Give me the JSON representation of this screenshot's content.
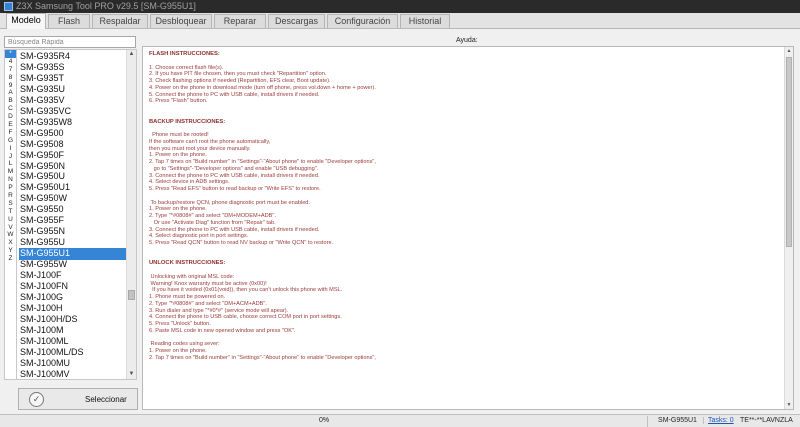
{
  "window": {
    "title": "Z3X Samsung Tool PRO v29.5 [SM-G955U1]"
  },
  "tabs": [
    "Modelo",
    "Flash",
    "Respaldar",
    "Desbloquear",
    "Reparar",
    "Descargas",
    "Configuración",
    "Historial"
  ],
  "active_tab": "Modelo",
  "search": {
    "placeholder": "Búsqueda Rápida",
    "value": ""
  },
  "alphabet": [
    "*",
    "4",
    "7",
    "8",
    "9",
    "A",
    "B",
    "C",
    "D",
    "E",
    "F",
    "G",
    "I",
    "J",
    "L",
    "M",
    "N",
    "P",
    "R",
    "S",
    "T",
    "U",
    "V",
    "W",
    "X",
    "Y",
    "Z"
  ],
  "alphabet_selected": "*",
  "models": [
    "SM-G935R4",
    "SM-G935S",
    "SM-G935T",
    "SM-G935U",
    "SM-G935V",
    "SM-G935VC",
    "SM-G935W8",
    "SM-G9500",
    "SM-G9508",
    "SM-G950F",
    "SM-G950N",
    "SM-G950U",
    "SM-G950U1",
    "SM-G950W",
    "SM-G9550",
    "SM-G955F",
    "SM-G955N",
    "SM-G955U",
    "SM-G955U1",
    "SM-G955W",
    "SM-J100F",
    "SM-J100FN",
    "SM-J100G",
    "SM-J100H",
    "SM-J100H/DS",
    "SM-J100M",
    "SM-J100ML",
    "SM-J100ML/DS",
    "SM-J100MU",
    "SM-J100MV"
  ],
  "selected_model": "SM-G955U1",
  "select_button": {
    "label": "Seleccionar",
    "icon": "check-circle-icon"
  },
  "help": {
    "title": "Ayuda:",
    "lines": [
      {
        "t": "FLASH INSTRUCCIONES:",
        "h": true
      },
      {
        "t": ""
      },
      {
        "t": "1. Choose correct flash file(s)."
      },
      {
        "t": "2. If you have PIT file chosen, then you must check \"Repartition\" option."
      },
      {
        "t": "3. Check flashing options if needed (Repartition, EFS clear, Boot update)."
      },
      {
        "t": "4. Power on the phone in download mode (turn off phone, press vol.down + home + power)."
      },
      {
        "t": "5. Connect the phone to PC with USB cable, install drivers if needed."
      },
      {
        "t": "6. Press \"Flash\" button."
      },
      {
        "t": ""
      },
      {
        "t": ""
      },
      {
        "t": "BACKUP INSTRUCCIONES:",
        "h": true
      },
      {
        "t": ""
      },
      {
        "t": "  Phone must be rooted!"
      },
      {
        "t": "If the software can't root the phone automatically,"
      },
      {
        "t": "then you must root your device manually."
      },
      {
        "t": "1. Power on the phone."
      },
      {
        "t": "2. Tap 7 times on \"Build number\" in \"Settings\"-\"About phone\" to enable \"Developer options\","
      },
      {
        "t": "   go to \"Settings\"-\"Developer options\" and enable \"USB debugging\"."
      },
      {
        "t": "3. Connect the phone to PC with USB cable, install drivers if needed."
      },
      {
        "t": "4. Select device in ADB settings."
      },
      {
        "t": "5. Press \"Read EFS\" button to read backup or \"Write EFS\" to restore."
      },
      {
        "t": ""
      },
      {
        "t": " To backup/restore QCN, phone diagnostic port must be enabled."
      },
      {
        "t": "1. Power on the phone."
      },
      {
        "t": "2. Type \"*#0808#\" and select \"DM+MODEM+ADB\"."
      },
      {
        "t": "   Or use \"Activate Diag\" function from \"Repair\" tab."
      },
      {
        "t": "3. Connect the phone to PC with USB cable, install drivers if needed."
      },
      {
        "t": "4. Select diagnostic port in port settings."
      },
      {
        "t": "5. Press \"Read QCN\" button to read NV backup or \"Write QCN\" to restore."
      },
      {
        "t": ""
      },
      {
        "t": ""
      },
      {
        "t": "UNLOCK INSTRUCCIONES:",
        "h": true
      },
      {
        "t": ""
      },
      {
        "t": " Unlocking with original MSL code:"
      },
      {
        "t": " Warning! Knox warranty must be active (0x00)!"
      },
      {
        "t": "  If you have it voided (0x01(void)), then you can't unlock this phone with MSL."
      },
      {
        "t": "1. Phone must be powered on."
      },
      {
        "t": "2. Type \"*#0808#\" and select \"DM+ACM+ADB\"."
      },
      {
        "t": "3. Run dialer and type \"*#0*#\" (service mode will apear)."
      },
      {
        "t": "4. Connect the phone to USB cable, choose correct COM port in port settings."
      },
      {
        "t": "5. Press \"Unlock\" button."
      },
      {
        "t": "6. Paste MSL code in new opened window and press \"OK\"."
      },
      {
        "t": ""
      },
      {
        "t": " Reading codes using sever:"
      },
      {
        "t": "1. Power on the phone."
      },
      {
        "t": "2. Tap 7 times on \"Build number\" in \"Settings\"-\"About phone\" to enable \"Developer options\","
      }
    ]
  },
  "status": {
    "progress_text": "0%",
    "progress_value": 0,
    "model": "SM-G955U1",
    "tasks": "Tasks: 0",
    "serial": "TE**-**LAVNZLA"
  },
  "colors": {
    "accent": "#3584d6",
    "help_text": "#9b3a3a",
    "titlebar": "#2a2a2a"
  }
}
